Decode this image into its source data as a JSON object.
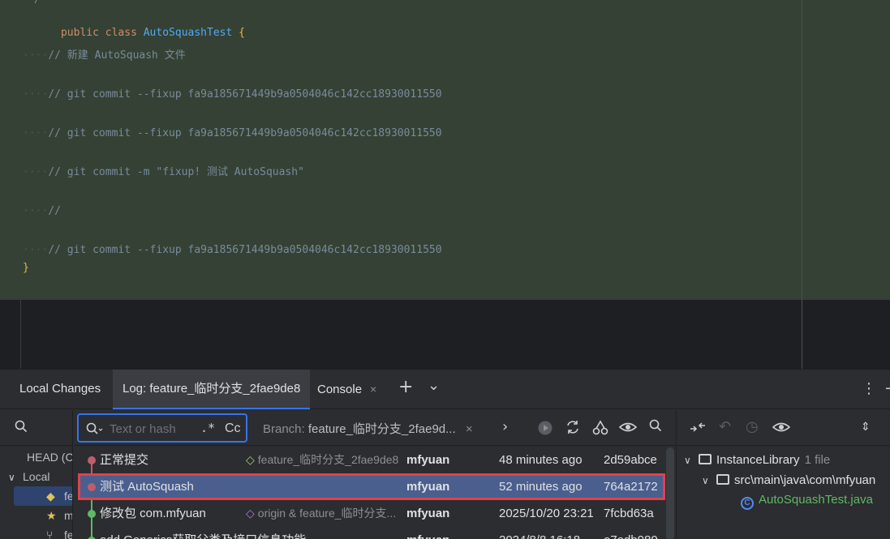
{
  "editor": {
    "stub": "*/",
    "lines": [
      {
        "kind": "class",
        "kw1": "public",
        "kw2": "class",
        "name": "AutoSquashTest",
        "brace": "{"
      },
      {
        "kind": "comment",
        "text": "// 新建 AutoSquash 文件"
      },
      {
        "kind": "comment",
        "text": "// git commit --fixup fa9a185671449b9a0504046c142cc18930011550"
      },
      {
        "kind": "comment",
        "text": "// git commit --fixup fa9a185671449b9a0504046c142cc18930011550"
      },
      {
        "kind": "comment",
        "text": "// git commit -m \"fixup! 测试 AutoSquash\""
      },
      {
        "kind": "comment",
        "text": "//"
      },
      {
        "kind": "comment",
        "text": "// git commit --fixup fa9a185671449b9a0504046c142cc18930011550"
      },
      {
        "kind": "close",
        "text": "}"
      }
    ]
  },
  "tabs": {
    "local_changes": "Local Changes",
    "log": "Log: feature_临时分支_2fae9de8",
    "console": "Console",
    "console_close": "×",
    "add": "+",
    "dropdown": "⌄",
    "more": "⋮",
    "minimize": "−"
  },
  "branches": {
    "head": "HEAD (C",
    "local": "Local",
    "items": [
      "fe",
      "m",
      "fe"
    ]
  },
  "log_toolbar": {
    "filter_placeholder": "Text or hash",
    "regex_label": ".*",
    "case_label": "Cc",
    "branch_label": "Branch:",
    "branch_value": "feature_临时分支_2fae9d...",
    "branch_clear": "×"
  },
  "commits": [
    {
      "subject": "正常提交",
      "refs": "feature_临时分支_2fae9de8",
      "author": "mfyuan",
      "date": "48 minutes ago",
      "hash": "2d59abce",
      "dot_color": "#c15c6b"
    },
    {
      "subject": "测试 AutoSquash",
      "refs": "",
      "author": "mfyuan",
      "date": "52 minutes ago",
      "hash": "764a2172",
      "dot_color": "#c15c6b",
      "selected": true
    },
    {
      "subject": "修改包 com.mfyuan",
      "refs": "origin & feature_临时分支...",
      "author": "mfyuan",
      "date": "2025/10/20 23:21",
      "hash": "7fcbd63a",
      "dot_color": "#5fb865"
    },
    {
      "subject": "add Generics获取父类及接口信息功能",
      "refs": "",
      "author": "mfyuan",
      "date": "2024/8/8 16:18",
      "hash": "e7edb980",
      "dot_color": "#5fb865"
    }
  ],
  "changes": {
    "root": "InstanceLibrary",
    "root_meta": "1 file",
    "path": "src\\main\\java\\com\\mfyuan",
    "file": "AutoSquashTest.java"
  }
}
